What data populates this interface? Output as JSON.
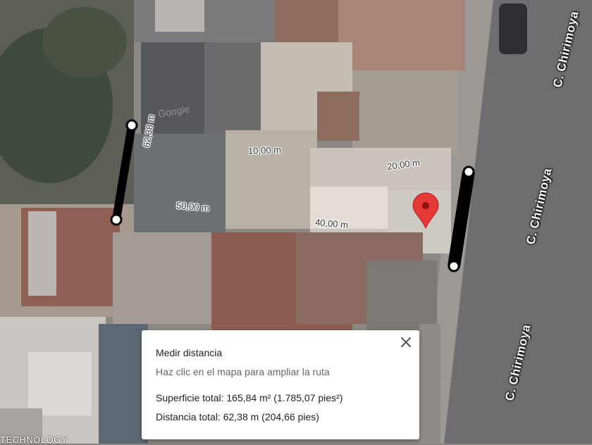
{
  "map": {
    "street_labels": [
      "C. Chirimoya",
      "C. Chirimoya",
      "C. Chirimoya"
    ],
    "watermark": "TECHNOLOGY",
    "faint_logo": "Google",
    "measure_labels": [
      "62,38 m",
      "10,00 m",
      "20,00 m",
      "50,00 m",
      "40,00 m"
    ]
  },
  "panel": {
    "title": "Medir distancia",
    "hint": "Haz clic en el mapa para ampliar la ruta",
    "area": "Superficie total: 165,84 m² (1.785,07 pies²)",
    "distance": "Distancia total: 62,38 m (204,66 pies)"
  },
  "icons": {
    "pin_color": "#e53935",
    "close_icon": "close-icon",
    "pin_icon": "map-pin-icon"
  }
}
